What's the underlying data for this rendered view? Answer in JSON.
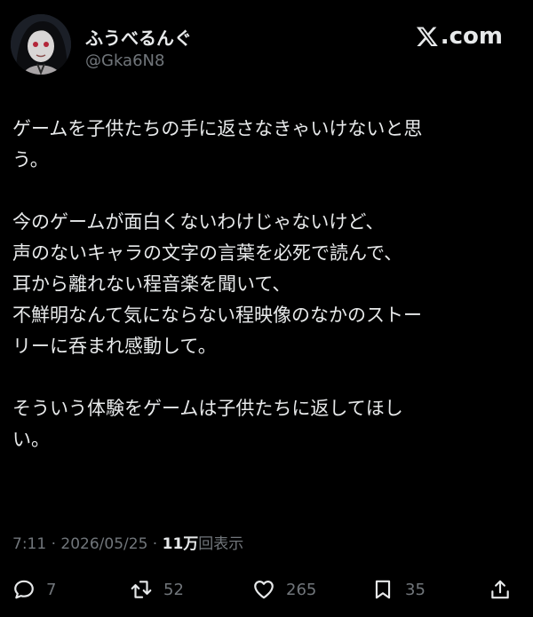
{
  "user": {
    "display_name": "ふうべるんぐ",
    "handle": "@Gka6N8"
  },
  "brand": {
    "logo_text": ".com",
    "logo_icon": "x-logo-icon"
  },
  "post": {
    "paragraphs": [
      [
        "ゲームを子供たちの手に返さなきゃいけないと思",
        "う。"
      ],
      [
        "今のゲームが面白くないわけじゃないけど、",
        "声のないキャラの文字の言葉を必死で読んで、",
        "耳から離れない程音楽を聞いて、",
        "不鮮明なんて気にならない程映像のなかのストー",
        "リーに呑まれ感動して。"
      ],
      [
        "そういう体験をゲームは子供たちに返してほし",
        "い。"
      ]
    ],
    "time": "7:11",
    "date": "2026/05/25",
    "separator": "·",
    "views_count": "11万",
    "views_label": "回表示"
  },
  "actions": {
    "replies": "7",
    "reposts": "52",
    "likes": "265",
    "bookmarks": "35"
  },
  "colors": {
    "background": "#000000",
    "text": "#e7e9ea",
    "muted": "#71767b"
  }
}
